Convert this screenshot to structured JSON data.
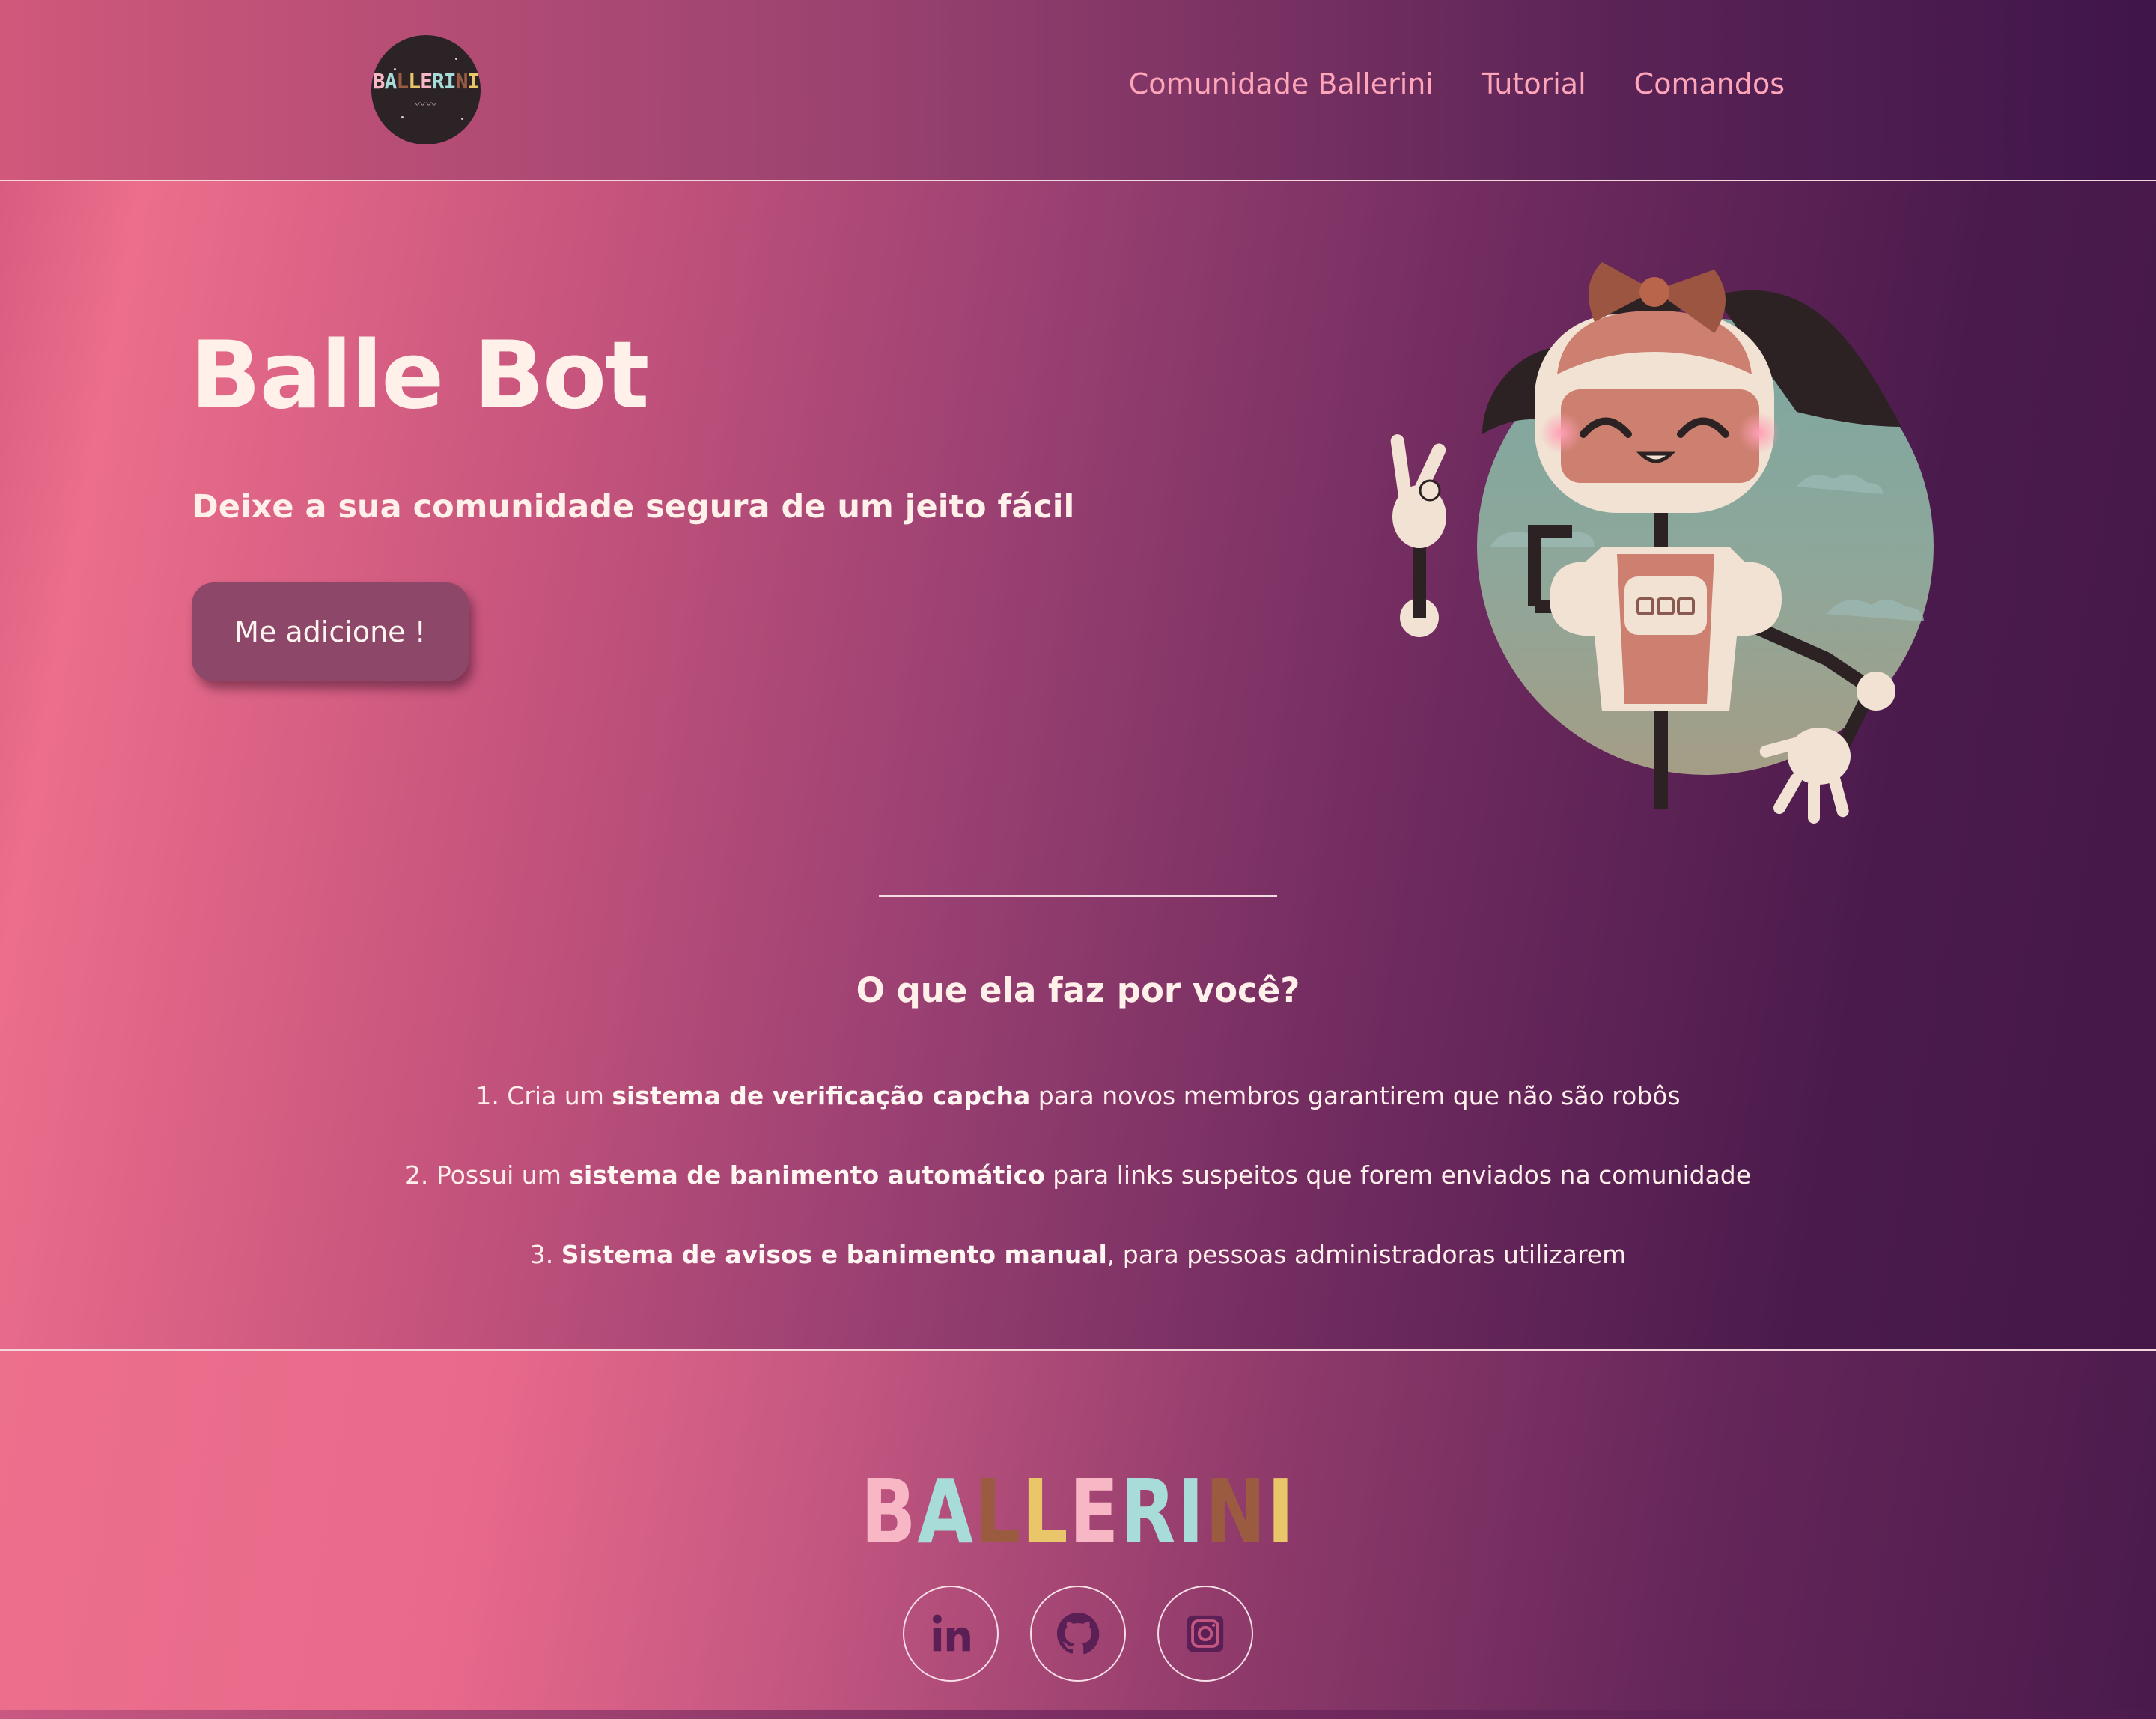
{
  "header": {
    "logo_text": "BALLERINI",
    "nav": [
      {
        "label": "Comunidade Ballerini"
      },
      {
        "label": "Tutorial"
      },
      {
        "label": "Comandos"
      }
    ]
  },
  "hero": {
    "title": "Balle Bot",
    "subtitle": "Deixe a sua comunidade segura de um jeito fácil",
    "button_label": "Me adicione !"
  },
  "features": {
    "heading": "O que ela faz por você?",
    "items": [
      {
        "prefix": "1. Cria um ",
        "bold": "sistema de verificação capcha",
        "suffix": " para novos membros garantirem que não são robôs"
      },
      {
        "prefix": "2. Possui um ",
        "bold": "sistema de banimento automático",
        "suffix": " para links suspeitos que forem enviados na comunidade"
      },
      {
        "prefix": "3. ",
        "bold": "Sistema de avisos e banimento manual",
        "suffix": ", para pessoas administradoras utilizarem"
      }
    ]
  },
  "footer": {
    "brand_letters": [
      "B",
      "A",
      "L",
      "L",
      "E",
      "R",
      "I",
      "N",
      "I"
    ],
    "brand_colors": [
      "#f7b7c4",
      "#a8dcd9",
      "#9b5b40",
      "#e9c66a",
      "#f7b7c4",
      "#a8dcd9",
      "#a8dcd9",
      "#9b5b40",
      "#e9c66a"
    ],
    "social": [
      {
        "name": "linkedin",
        "icon": "linkedin-icon"
      },
      {
        "name": "github",
        "icon": "github-icon"
      },
      {
        "name": "instagram",
        "icon": "instagram-icon"
      }
    ]
  },
  "colors": {
    "nav_link": "#ffa5b9",
    "text_light": "#fff1ea",
    "button_bg": "#8d4768",
    "icon_purple": "#5a1f55"
  }
}
